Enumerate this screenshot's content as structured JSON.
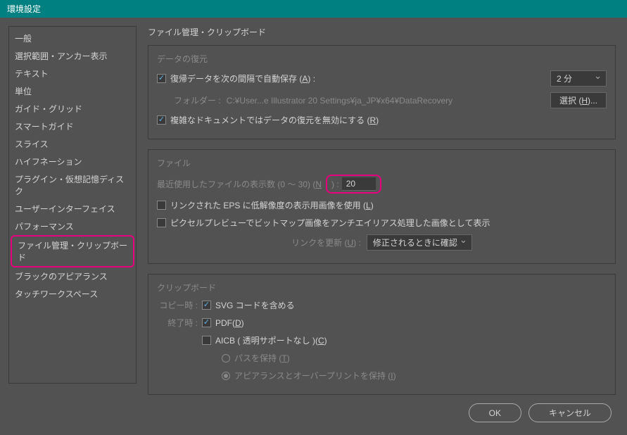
{
  "title": "環境設定",
  "sidebar": {
    "items": [
      "一般",
      "選択範囲・アンカー表示",
      "テキスト",
      "単位",
      "ガイド・グリッド",
      "スマートガイド",
      "スライス",
      "ハイフネーション",
      "プラグイン・仮想記憶ディスク",
      "ユーザーインターフェイス",
      "パフォーマンス",
      "ファイル管理・クリップボード",
      "ブラックのアピアランス",
      "タッチワークスペース"
    ],
    "selectedIndex": 11
  },
  "main": {
    "heading": "ファイル管理・クリップボード",
    "dataRecovery": {
      "groupLabel": "データの復元",
      "autosave": {
        "checked": true,
        "label": "復帰データを次の間隔で自動保存 (",
        "mnemonic": "A",
        "labelSuffix": ") :",
        "intervalValue": "2 分"
      },
      "folder": {
        "label": "フォルダー :",
        "path": "C:¥User...e Illustrator 20 Settings¥ja_JP¥x64¥DataRecovery",
        "buttonLabel": "選択 (",
        "buttonMnemonic": "H",
        "buttonSuffix": ")..."
      },
      "disableComplex": {
        "checked": true,
        "label": "複雑なドキュメントではデータの復元を無効にする (",
        "mnemonic": "R",
        "labelSuffix": ")"
      }
    },
    "file": {
      "groupLabel": "ファイル",
      "recentFiles": {
        "label": "最近使用したファイルの表示数 (0 ～ 30) (",
        "mnemonic": "N",
        "labelSuffix": ") :",
        "value": "20"
      },
      "epsLowRes": {
        "checked": false,
        "label": "リンクされた EPS に低解像度の表示用画像を使用 (",
        "mnemonic": "L",
        "labelSuffix": ")"
      },
      "pixelAntiAlias": {
        "checked": false,
        "label": "ピクセルプレビューでビットマップ画像をアンチエイリアス処理した画像として表示"
      },
      "updateLinks": {
        "label": "リンクを更新 (",
        "mnemonic": "U",
        "labelSuffix": ") :",
        "value": "修正されるときに確認"
      }
    },
    "clipboard": {
      "groupLabel": "クリップボード",
      "copyLabel": "コピー時 :",
      "svg": {
        "checked": true,
        "label": "SVG コードを含める"
      },
      "quitLabel": "終了時 :",
      "pdf": {
        "checked": true,
        "label": "PDF(",
        "mnemonic": "D",
        "labelSuffix": ")"
      },
      "aicb": {
        "checked": false,
        "label": "AICB ( 透明サポートなし )(",
        "mnemonic": "C",
        "labelSuffix": ")"
      },
      "preservePath": {
        "checked": false,
        "label": "パスを保持 (",
        "mnemonic": "T",
        "labelSuffix": ")"
      },
      "preserveAppearance": {
        "checked": true,
        "label": "アピアランスとオーバープリントを保持 (",
        "mnemonic": "I",
        "labelSuffix": ")"
      }
    }
  },
  "footer": {
    "ok": "OK",
    "cancel": "キャンセル"
  }
}
